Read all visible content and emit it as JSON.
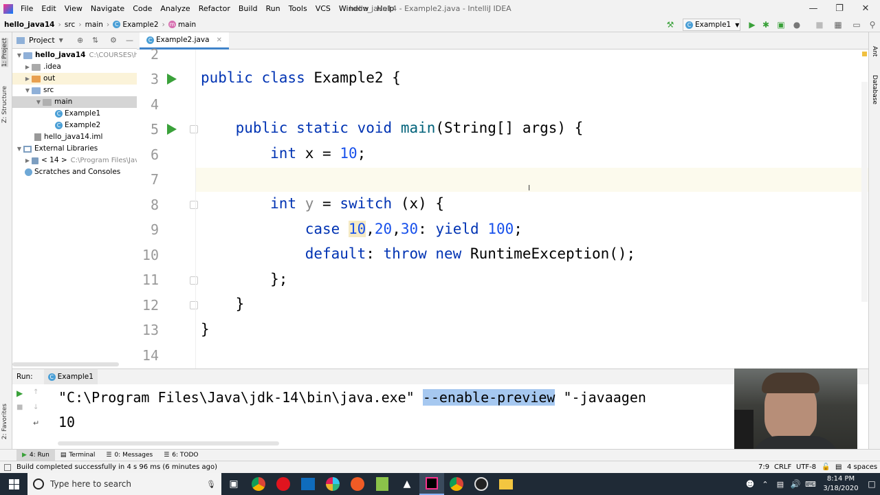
{
  "window": {
    "title": "hello_java14 - Example2.java - IntelliJ IDEA"
  },
  "menu": [
    "File",
    "Edit",
    "View",
    "Navigate",
    "Code",
    "Analyze",
    "Refactor",
    "Build",
    "Run",
    "Tools",
    "VCS",
    "Window",
    "Help"
  ],
  "breadcrumb": {
    "project": "hello_java14",
    "src": "src",
    "pkg": "main",
    "cls": "Example2",
    "method": "main"
  },
  "toolbar": {
    "run_config": "Example1"
  },
  "left_tools": {
    "project": "1: Project",
    "structure": "Z: Structure",
    "favorites": "2: Favorites"
  },
  "right_tools": {
    "ant": "Ant",
    "database": "Database"
  },
  "project_panel": {
    "title": "Project",
    "tree": [
      {
        "label": "hello_java14",
        "extra": "C:\\COURSES\\hello_j"
      },
      {
        "label": ".idea"
      },
      {
        "label": "out"
      },
      {
        "label": "src"
      },
      {
        "label": "main"
      },
      {
        "label": "Example1"
      },
      {
        "label": "Example2"
      },
      {
        "label": "hello_java14.iml"
      },
      {
        "label": "External Libraries"
      },
      {
        "label": "< 14 >",
        "extra": "C:\\Program Files\\Java\\"
      },
      {
        "label": "Scratches and Consoles"
      }
    ]
  },
  "editor": {
    "tab": "Example2.java",
    "line_numbers": [
      "2",
      "3",
      "4",
      "5",
      "6",
      "7",
      "8",
      "9",
      "10",
      "11",
      "12",
      "13",
      "14"
    ]
  },
  "run_panel": {
    "label": "Run:",
    "config": "Example1",
    "cmd_path": "\"C:\\Program Files\\Java\\jdk-14\\bin\\java.exe\" ",
    "cmd_flag": "--enable-preview",
    "cmd_rest": " \"-javaagen",
    "output": "10"
  },
  "bottom_tabs": {
    "run": "4: Run",
    "terminal": "Terminal",
    "messages": "0: Messages",
    "todo": "6: TODO"
  },
  "status": {
    "message": "Build completed successfully in 4 s 96 ms (6 minutes ago)",
    "position": "7:9",
    "line_sep": "CRLF",
    "encoding": "UTF-8",
    "indent": "4 spaces"
  },
  "taskbar": {
    "search": "Type here to search",
    "time": "8:14 PM",
    "date": "3/18/2020"
  }
}
